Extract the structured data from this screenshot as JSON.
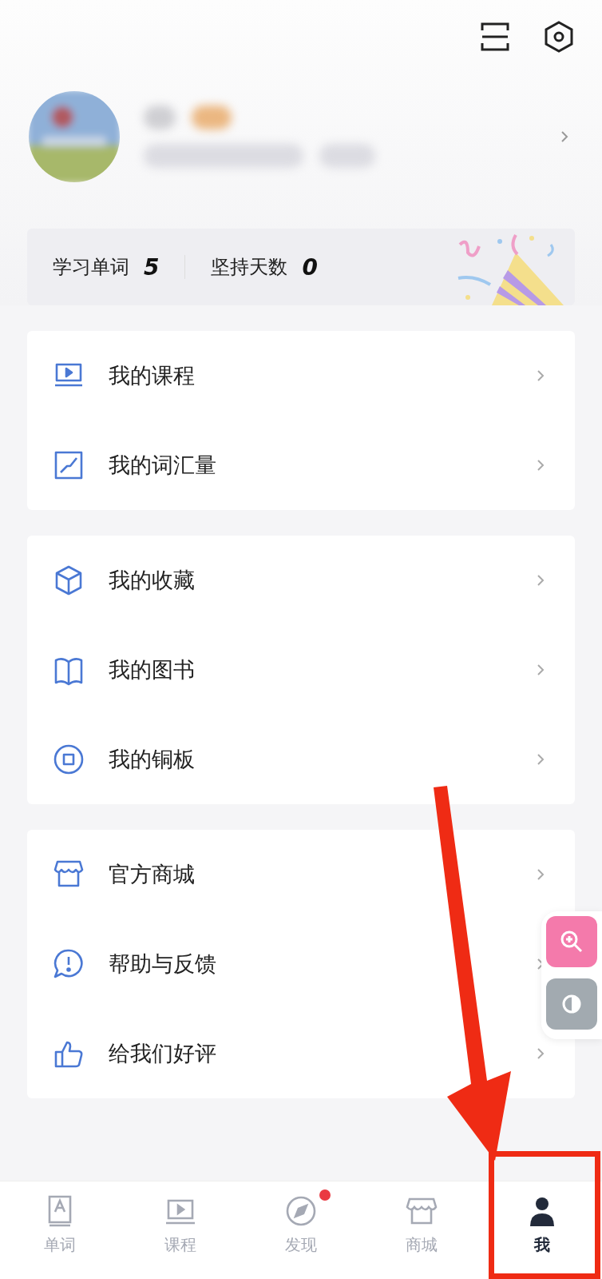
{
  "stats": [
    {
      "label": "学习单词",
      "value": "5"
    },
    {
      "label": "坚持天数",
      "value": "0"
    }
  ],
  "menu_groups": [
    {
      "items": [
        {
          "label": "我的课程"
        },
        {
          "label": "我的词汇量"
        }
      ]
    },
    {
      "items": [
        {
          "label": "我的收藏"
        },
        {
          "label": "我的图书"
        },
        {
          "label": "我的铜板"
        }
      ]
    },
    {
      "items": [
        {
          "label": "官方商城"
        },
        {
          "label": "帮助与反馈"
        },
        {
          "label": "给我们好评"
        }
      ]
    }
  ],
  "tab_bar": [
    {
      "label": "单词",
      "selected": false,
      "dot": false
    },
    {
      "label": "课程",
      "selected": false,
      "dot": false
    },
    {
      "label": "发现",
      "selected": false,
      "dot": true
    },
    {
      "label": "商城",
      "selected": false,
      "dot": false
    },
    {
      "label": "我",
      "selected": true,
      "dot": false
    }
  ]
}
